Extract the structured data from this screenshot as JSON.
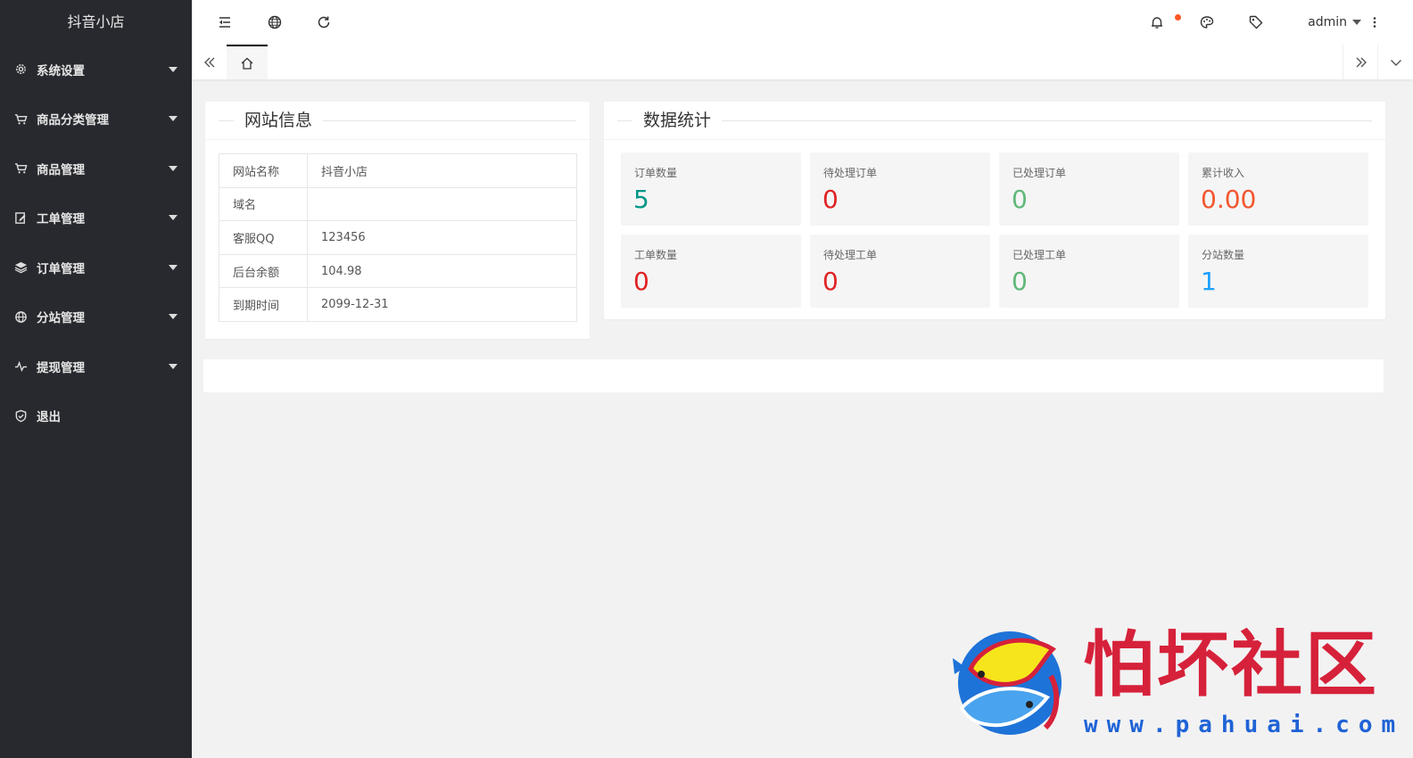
{
  "sidebar": {
    "logo": "抖音小店",
    "items": [
      {
        "label": "系统设置",
        "icon": "gear-icon"
      },
      {
        "label": "商品分类管理",
        "icon": "cart-icon"
      },
      {
        "label": "商品管理",
        "icon": "cart-icon"
      },
      {
        "label": "工单管理",
        "icon": "edit-doc-icon"
      },
      {
        "label": "订单管理",
        "icon": "layers-icon"
      },
      {
        "label": "分站管理",
        "icon": "globe-icon"
      },
      {
        "label": "提现管理",
        "icon": "pulse-icon"
      },
      {
        "label": "退出",
        "icon": "shield-check-icon"
      }
    ]
  },
  "header": {
    "user": "admin",
    "icons": [
      "menu-fold-icon",
      "globe-icon",
      "refresh-icon",
      "bell-icon",
      "theme-palette-icon",
      "tag-icon",
      "more-vertical-icon"
    ]
  },
  "site_info": {
    "title": "网站信息",
    "rows": [
      {
        "key": "网站名称",
        "value": "抖音小店"
      },
      {
        "key": "域名",
        "value": ""
      },
      {
        "key": "客服QQ",
        "value": "123456"
      },
      {
        "key": "后台余额",
        "value": "104.98"
      },
      {
        "key": "到期时间",
        "value": "2099-12-31"
      }
    ]
  },
  "stats": {
    "title": "数据统计",
    "items": [
      {
        "label": "订单数量",
        "value": "5",
        "color": "#009688"
      },
      {
        "label": "待处理订单",
        "value": "0",
        "color": "#e02222"
      },
      {
        "label": "已处理订单",
        "value": "0",
        "color": "#5fb878"
      },
      {
        "label": "累计收入",
        "value": "0.00",
        "color": "#f2562d"
      },
      {
        "label": "工单数量",
        "value": "0",
        "color": "#e02222"
      },
      {
        "label": "待处理工单",
        "value": "0",
        "color": "#e02222"
      },
      {
        "label": "已处理工单",
        "value": "0",
        "color": "#5fb878"
      },
      {
        "label": "分站数量",
        "value": "1",
        "color": "#1e9fff"
      }
    ]
  },
  "watermark": {
    "text": "怕坏社区",
    "url": "www.pahuai.com"
  }
}
